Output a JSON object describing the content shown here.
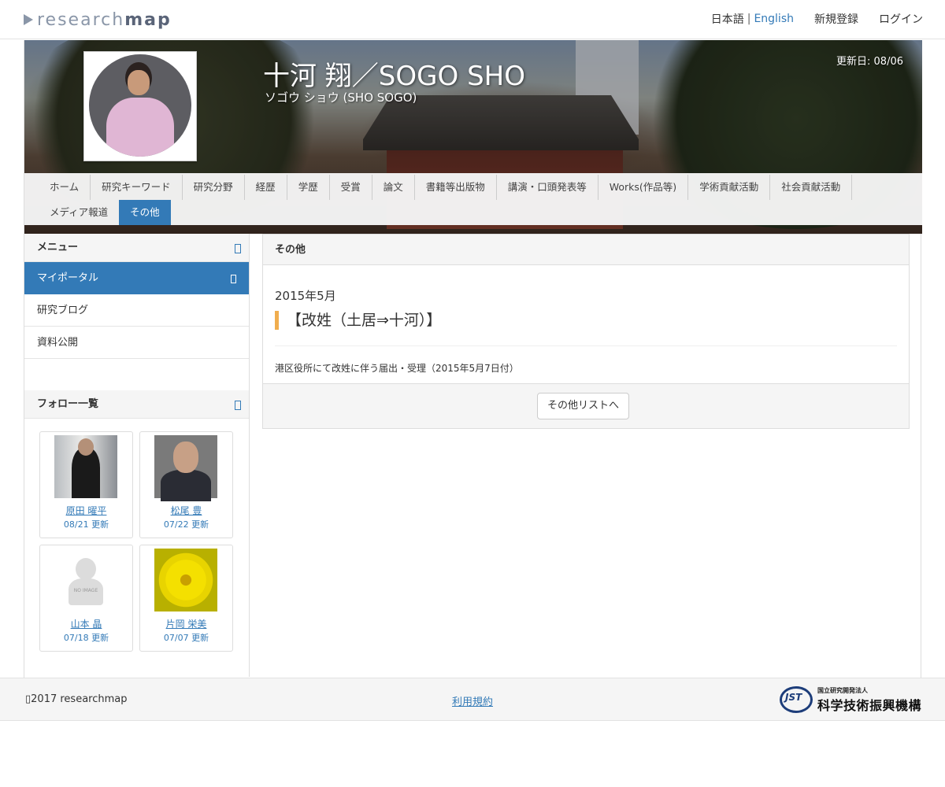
{
  "topbar": {
    "logo_light": "research",
    "logo_bold": "map",
    "lang_ja": "日本語",
    "lang_sep": "|",
    "lang_en": "English",
    "register": "新規登録",
    "login": "ログイン"
  },
  "profile": {
    "name": "十河 翔／SOGO SHO",
    "kana": "ソゴウ ショウ (SHO SOGO)",
    "updated": "更新日: 08/06"
  },
  "tabs": {
    "row1": [
      "ホーム",
      "研究キーワード",
      "研究分野",
      "経歴",
      "学歴",
      "受賞",
      "論文",
      "書籍等出版物",
      "講演・口頭発表等",
      "Works(作品等)",
      "学術貢献活動",
      "社会貢献活動"
    ],
    "row2": [
      "メディア報道",
      "その他"
    ],
    "active": "その他"
  },
  "sidebar": {
    "menu_title": "メニュー",
    "menu_items": [
      "マイポータル",
      "研究ブログ",
      "資料公開"
    ],
    "follow_title": "フォロー一覧",
    "follows": [
      {
        "name": "原田 曜平",
        "date": "08/21 更新"
      },
      {
        "name": "松尾 豊",
        "date": "07/22 更新"
      },
      {
        "name": "山本 晶",
        "date": "07/18 更新",
        "noimage": "NO IMAGE"
      },
      {
        "name": "片岡 栄美",
        "date": "07/07 更新"
      }
    ]
  },
  "main": {
    "heading": "その他",
    "entry_date": "2015年5月",
    "entry_title": "【改姓（土居⇒十河）】",
    "entry_desc": "港区役所にて改姓に伴う届出・受理（2015年5月7日付）",
    "list_button": "その他リストへ"
  },
  "footer": {
    "copyright": "▯2017 researchmap",
    "terms": "利用規約",
    "jst_mark": "JST",
    "jst_small": "国立研究開発法人",
    "jst_big": "科学技術振興機構"
  }
}
